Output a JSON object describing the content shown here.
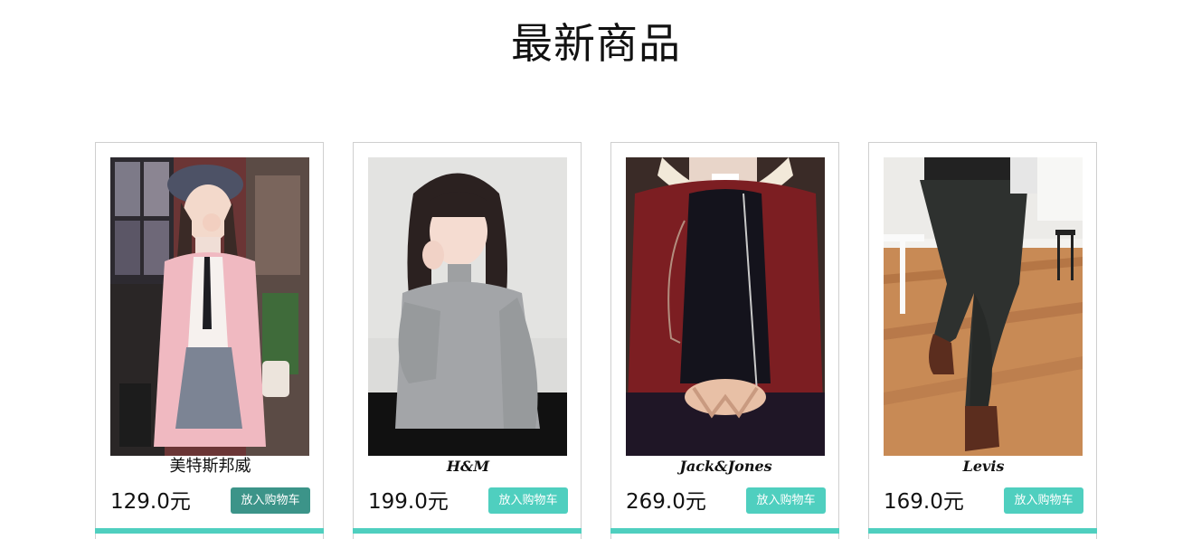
{
  "section": {
    "title": "最新商品"
  },
  "colors": {
    "accent": "#4fcfbf",
    "accent_hover": "#3c9489"
  },
  "products": [
    {
      "brand": "美特斯邦威",
      "price": "129.0元",
      "button_label": "放入购物车",
      "image": "woman-pink-cardigan-photo"
    },
    {
      "brand": "H&M",
      "price": "199.0元",
      "button_label": "放入购物车",
      "image": "woman-gray-sweater-photo"
    },
    {
      "brand": "Jack&Jones",
      "price": "269.0元",
      "button_label": "放入购物车",
      "image": "man-burgundy-jacket-photo"
    },
    {
      "brand": "Levis",
      "price": "169.0元",
      "button_label": "放入购物车",
      "image": "man-dark-trousers-photo"
    }
  ]
}
